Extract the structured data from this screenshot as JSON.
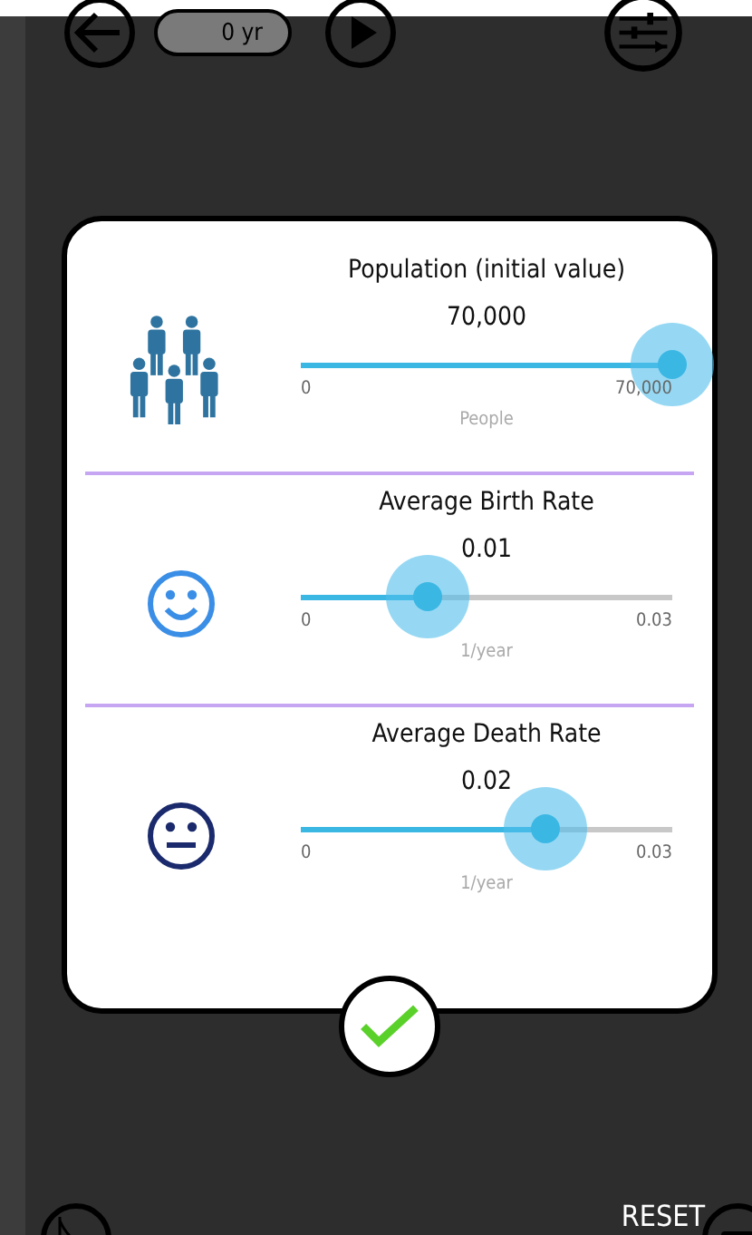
{
  "toolbar": {
    "time": "0 yr"
  },
  "parameters": [
    {
      "kind": "people",
      "title": "Population (initial value)",
      "value": "70,000",
      "min": "0",
      "max": "70,000",
      "unit": "People",
      "level": 1
    },
    {
      "kind": "happy",
      "title": "Average Birth Rate",
      "value": "0.01",
      "min": "0",
      "max": "0.03",
      "unit": "1/year",
      "level": 0.34
    },
    {
      "kind": "neutral",
      "title": "Average Death Rate",
      "value": "0.02",
      "min": "0",
      "max": "0.03",
      "unit": "1/year",
      "level": 0.66
    }
  ],
  "reset": "RESET"
}
